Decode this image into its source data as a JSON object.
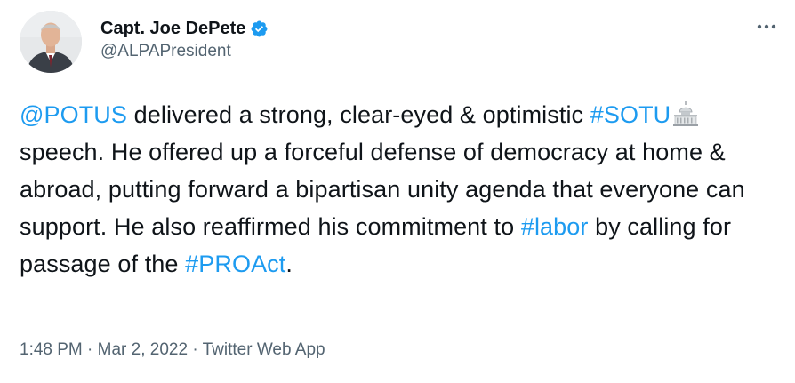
{
  "author": {
    "display_name": "Capt. Joe DePete",
    "handle": "@ALPAPresident",
    "verified": true,
    "avatar_icon": "person-avatar"
  },
  "menu_icon": "more-horizontal-icon",
  "tweet": {
    "seg1": "@POTUS",
    "seg2": " delivered a strong, clear-eyed & optimistic ",
    "seg3": "#SOTU",
    "emoji": "capitol-building-emoji",
    "seg4": " speech. He offered up a forceful defense of democracy at home & abroad, putting forward a bipartisan unity agenda that everyone can support. He also reaffirmed his commitment to ",
    "seg5": "#labor",
    "seg6": " by calling for passage of the ",
    "seg7": "#PROAct",
    "seg8": "."
  },
  "meta": {
    "time": "1:48 PM",
    "sep": " · ",
    "date": "Mar 2, 2022",
    "source": "Twitter Web App"
  },
  "colors": {
    "link": "#1d9bf0",
    "text": "#0f1419",
    "secondary": "#536471"
  }
}
